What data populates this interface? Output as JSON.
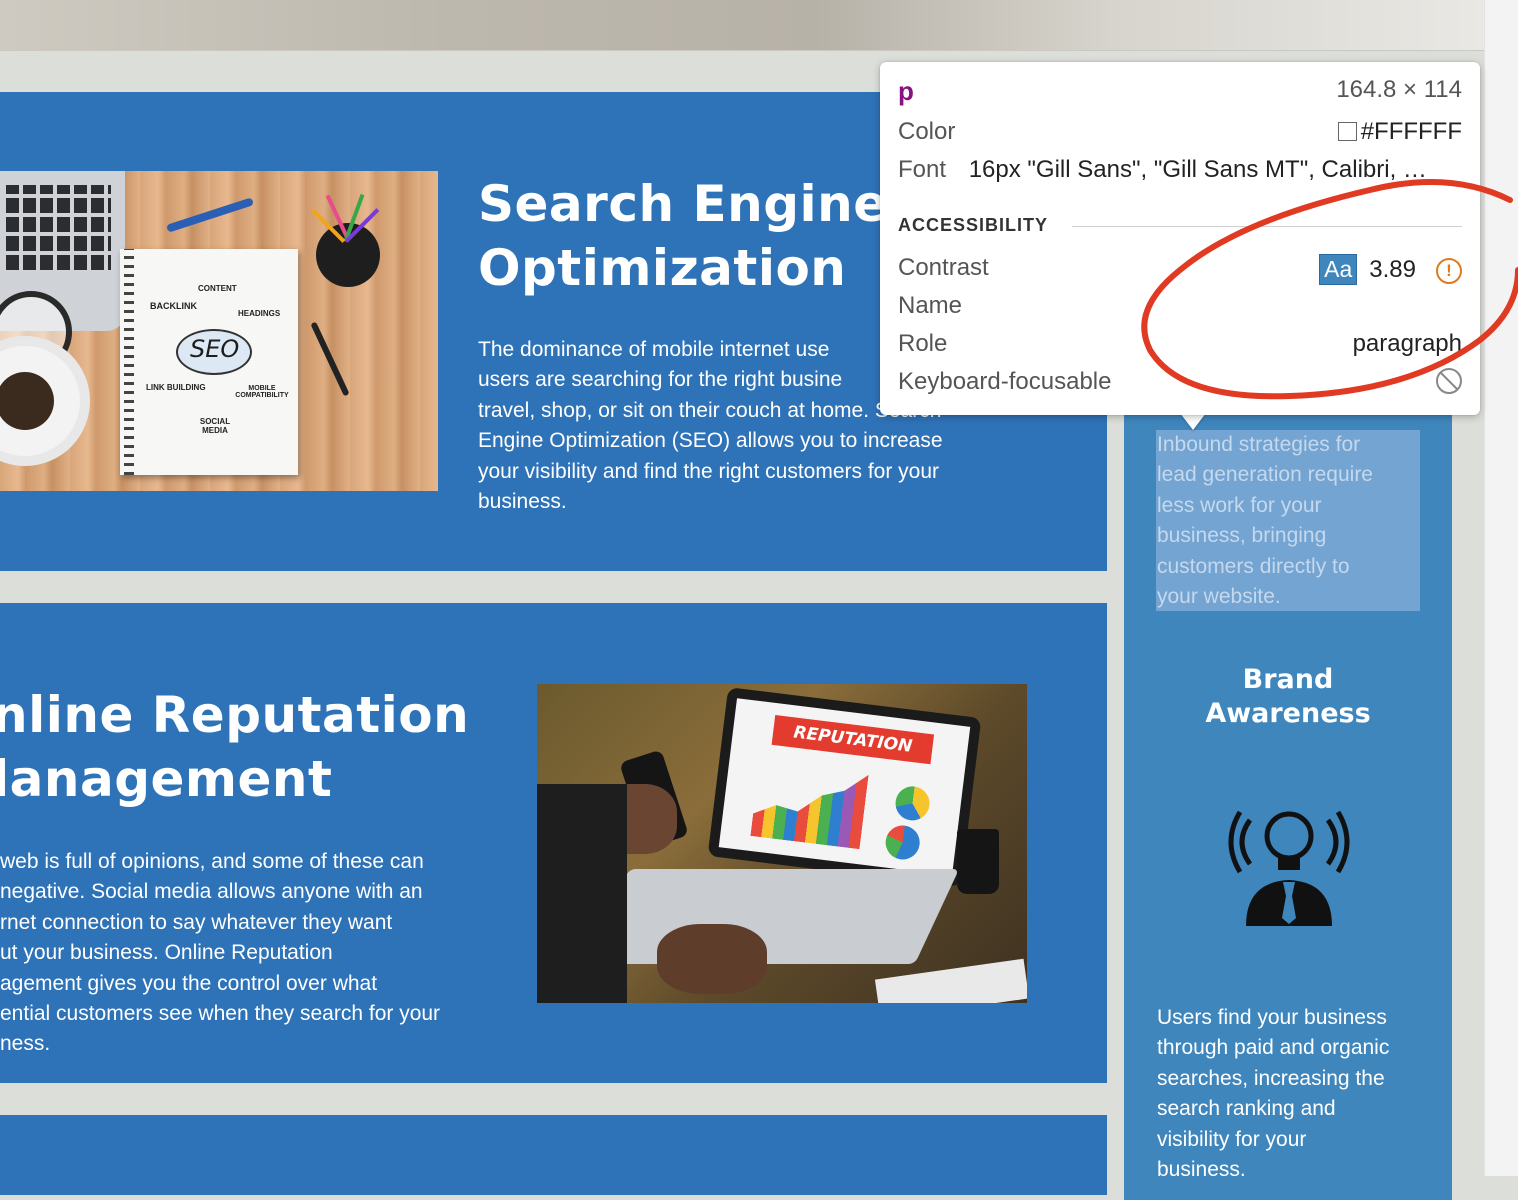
{
  "seo": {
    "title_line1": "Search Engine",
    "title_line2": "Optimization",
    "body": [
      "The dominance of mobile internet use",
      "users are searching for the right busine",
      "travel, shop, or sit on their couch at home. Search",
      "Engine Optimization (SEO) allows you to increase",
      "your visibility and find the right customers for your",
      "business."
    ],
    "image": {
      "labels": [
        "CONTENT",
        "BACKLINK",
        "HEADINGS",
        "SEO",
        "LINK BUILDING",
        "MOBILE COMPATIBILITY",
        "SOCIAL MEDIA"
      ]
    }
  },
  "orm": {
    "title_line1": "nline Reputation",
    "title_line2": "lanagement",
    "body": [
      " web is full of opinions, and some of these can",
      "negative. Social media allows anyone with an",
      "rnet connection to say whatever they want",
      "ut your business. Online Reputation",
      "agement gives you the control over what",
      "ential customers see when they search for your",
      "ness."
    ],
    "image": {
      "banner": "REPUTATION"
    }
  },
  "sidebar": {
    "inbound_text": [
      "Inbound strategies for",
      "lead generation require",
      "less work for your",
      "business, bringing",
      "customers directly to",
      "your website."
    ],
    "brand_title_line1": "Brand",
    "brand_title_line2": "Awareness",
    "brand_icon": "lightbulb-person-icon",
    "brand_text": [
      "Users find your business",
      "through paid and organic",
      "searches, increasing the",
      "search ranking and",
      "visibility for your",
      "business."
    ]
  },
  "devtools_tooltip": {
    "tag": "p",
    "size": "164.8 × 114",
    "color_label": "Color",
    "color_value": "#FFFFFF",
    "font_label": "Font",
    "font_value": "16px \"Gill Sans\", \"Gill Sans MT\", Calibri, …",
    "section": "ACCESSIBILITY",
    "contrast_label": "Contrast",
    "contrast_badge": "Aa",
    "contrast_value": "3.89",
    "contrast_icon": "warning-icon",
    "name_label": "Name",
    "role_label": "Role",
    "role_value": "paragraph",
    "focus_label": "Keyboard-focusable",
    "focus_icon": "not-allowed-icon"
  },
  "annotation": {
    "color": "#e03a22"
  },
  "colors": {
    "panel_blue": "#2e72b7",
    "side_blue": "#3f86bd",
    "background": "#dcdfd9"
  }
}
